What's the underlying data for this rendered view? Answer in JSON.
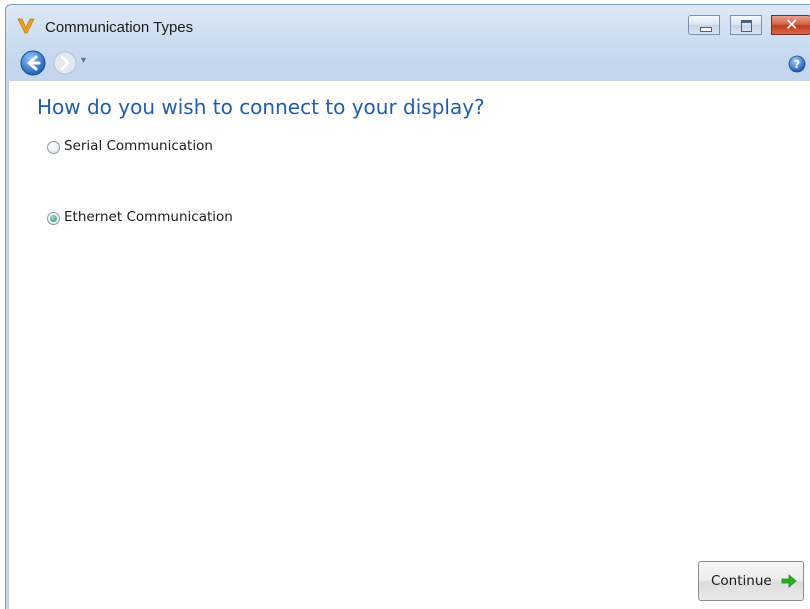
{
  "window": {
    "title": "Communication Types",
    "app_icon": "app-logo-icon",
    "buttons": {
      "minimize": "minimize-icon",
      "maximize": "maximize-icon",
      "close": "close-icon"
    }
  },
  "nav": {
    "back_icon": "back-arrow-icon",
    "forward_icon": "forward-arrow-icon",
    "dropdown_glyph": "▾",
    "help_icon": "help-icon"
  },
  "main": {
    "heading": "How do you wish to connect to your display?",
    "options": [
      {
        "label": "Serial Communication",
        "selected": false
      },
      {
        "label": "Ethernet Communication",
        "selected": true
      }
    ],
    "continue_label": "Continue",
    "continue_icon": "green-arrow-icon"
  },
  "colors": {
    "heading": "#1e5fa8",
    "frame": "#cfdff1",
    "close_button": "#c13a1e",
    "arrow": "#22b322"
  }
}
